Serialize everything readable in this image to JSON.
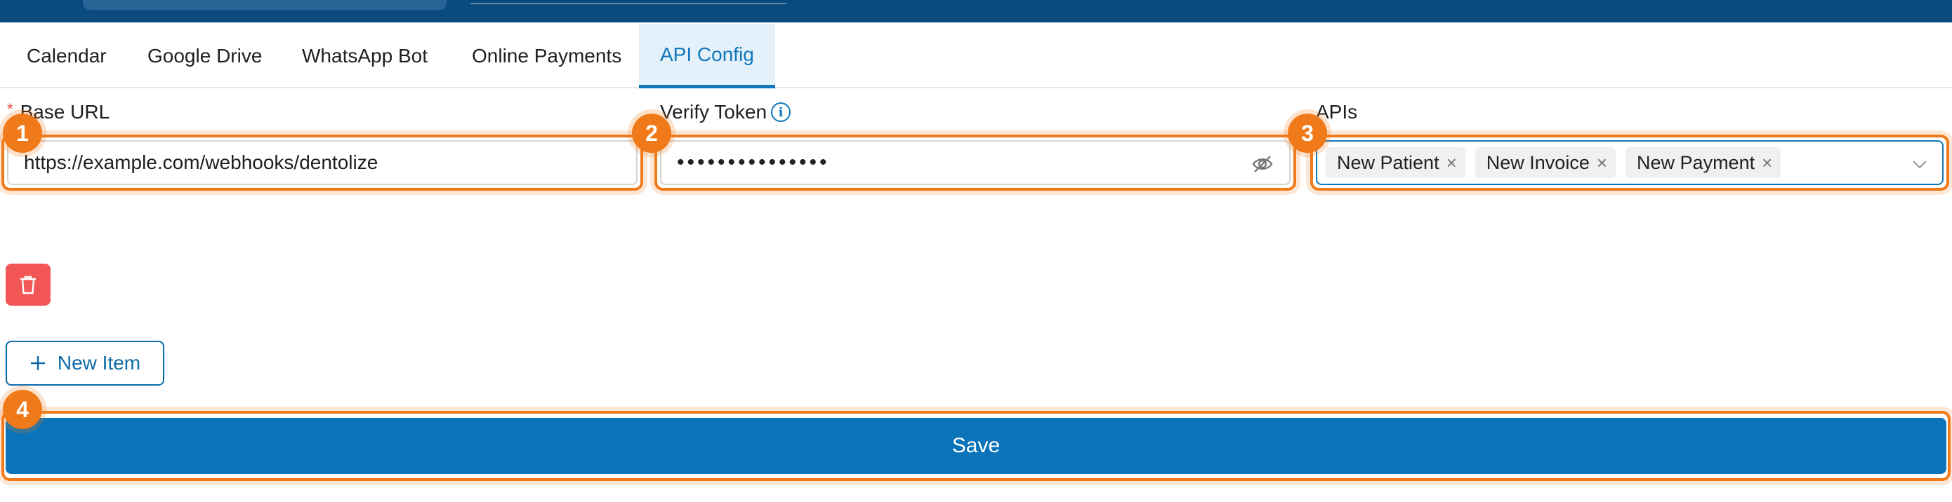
{
  "tabs": [
    {
      "label": "Calendar",
      "active": false
    },
    {
      "label": "Google Drive",
      "active": false
    },
    {
      "label": "WhatsApp Bot",
      "active": false
    },
    {
      "label": "Online Payments",
      "active": false
    },
    {
      "label": "API Config",
      "active": true
    }
  ],
  "form": {
    "base_url": {
      "label": "Base URL",
      "required_marker": "*",
      "value": "https://example.com/webhooks/dentolize"
    },
    "verify_token": {
      "label": "Verify Token",
      "info_icon": "i",
      "masked_value": "•••••••••••••••"
    },
    "apis": {
      "label": "APIs",
      "selected": [
        "New Patient",
        "New Invoice",
        "New Payment"
      ],
      "remove_glyph": "×"
    }
  },
  "actions": {
    "new_item_label": "New Item",
    "save_label": "Save"
  },
  "annotations": [
    "1",
    "2",
    "3",
    "4"
  ],
  "colors": {
    "header": "#0b4a7f",
    "accent": "#1177bb",
    "danger": "#f25656",
    "highlight": "#f07a1a",
    "save": "#0b74b8"
  }
}
